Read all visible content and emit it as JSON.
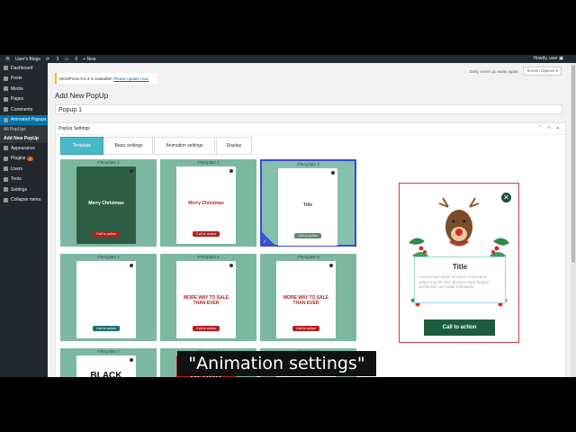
{
  "adminbar": {
    "site_name": "User's Blogs",
    "updates_count": "3",
    "comments_count": "0",
    "new_label": "+ New",
    "howdy": "Howdy, user"
  },
  "sidebar": {
    "items": [
      {
        "label": "Dashboard",
        "icon": "dashboard-icon"
      },
      {
        "label": "Posts",
        "icon": "posts-icon"
      },
      {
        "label": "Media",
        "icon": "media-icon"
      },
      {
        "label": "Pages",
        "icon": "pages-icon"
      },
      {
        "label": "Comments",
        "icon": "comments-icon"
      },
      {
        "label": "Animated Popups",
        "icon": "popups-icon"
      }
    ],
    "sub_items": [
      "All PopUps",
      "Add New PopUp"
    ],
    "items_after": [
      {
        "label": "Appearance",
        "icon": "appearance-icon"
      },
      {
        "label": "Plugins",
        "icon": "plugins-icon",
        "badge": "2"
      },
      {
        "label": "Users",
        "icon": "users-icon"
      },
      {
        "label": "Tools",
        "icon": "tools-icon"
      },
      {
        "label": "Settings",
        "icon": "settings-icon"
      },
      {
        "label": "Collapse menu",
        "icon": "collapse-icon"
      }
    ]
  },
  "header": {
    "dolly_text": "Dolly, never go away again",
    "screen_options": "Screen Options ▾",
    "notice_text": "WordPress 5.5.3 is available!",
    "notice_link": "Please update now.",
    "page_title": "Add New PopUp",
    "title_value": "Popup 1"
  },
  "panel": {
    "title": "PopUp Settings",
    "controls": "^ v ▴",
    "tabs": [
      {
        "label": "Template",
        "active": true
      },
      {
        "label": "Basic settings",
        "active": false
      },
      {
        "label": "Animation settings",
        "active": false
      },
      {
        "label": "Display",
        "active": false
      }
    ]
  },
  "templates": [
    {
      "label": "#Template 1",
      "cta": "Call to action",
      "bg": "#2d5e43",
      "cta_color": "#b51f1f",
      "heading": "Merry Christmas",
      "text": ""
    },
    {
      "label": "#Template 2",
      "cta": "Call to action",
      "bg": "#ffffff",
      "cta_color": "#b51f1f",
      "heading": "Merry Christmas",
      "text": ""
    },
    {
      "label": "#Template 3",
      "cta": "Call to action",
      "bg": "#ffffff",
      "cta_color": "#5e8a72",
      "heading": "Title",
      "text": ""
    },
    {
      "label": "#Template 4",
      "cta": "Call to action",
      "bg": "#ffffff",
      "cta_color": "#1b6d75",
      "heading": "",
      "text": ""
    },
    {
      "label": "#Template 5",
      "cta": "Call to action",
      "bg": "#ffffff",
      "cta_color": "#b51f1f",
      "heading": "MORE WAY TO SALE THAN EVER",
      "text": ""
    },
    {
      "label": "#Template 6",
      "cta": "Call to action",
      "bg": "#ffffff",
      "cta_color": "#b51f1f",
      "heading": "MORE WAY TO SALE THAN EVER",
      "text": ""
    },
    {
      "label": "#Template 7",
      "cta": "",
      "bg": "#ffffff",
      "cta_color": "#333333",
      "heading": "BLACK",
      "text": ""
    },
    {
      "label": "#Template 8",
      "cta": "",
      "bg": "#b51f1f",
      "cta_color": "#333333",
      "heading": "BLACK",
      "text": ""
    },
    {
      "label": "#Template 9",
      "cta": "",
      "bg": "#ffffff",
      "cta_color": "#333333",
      "heading": "",
      "text": ""
    }
  ],
  "preview": {
    "title": "Title",
    "text": "Lorem ipsum dolor sit amet, consectetur adipiscing elit. Nec aliquam turpis feugiat vestibulum sed sodal sollicitudin",
    "cta": "Call to action",
    "close": "✕"
  },
  "caption": "\"Animation settings\""
}
